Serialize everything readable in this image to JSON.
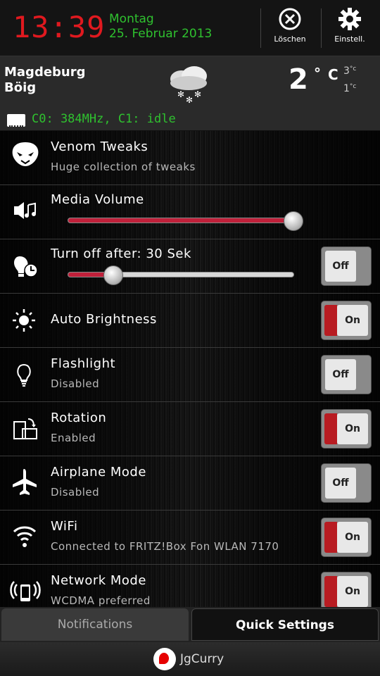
{
  "status": {
    "time": "13:39",
    "day": "Montag",
    "date": "25. Februar 2013",
    "clear_label": "Löschen",
    "settings_label": "Einstell."
  },
  "weather": {
    "city": "Magdeburg",
    "condition": "Böig",
    "temp": "2",
    "unit_deg": "°",
    "unit_c": "C",
    "high": "3",
    "low": "1",
    "small_unit": "°c"
  },
  "cpu": {
    "text": "C0: 384MHz, C1: idle"
  },
  "rows": {
    "venom": {
      "title": "Venom Tweaks",
      "subtitle": "Huge collection of tweaks"
    },
    "media": {
      "title": "Media Volume",
      "level": 1.0
    },
    "timeout": {
      "title": "Turn off after: 30 Sek",
      "level": 0.2,
      "toggle": "Off"
    },
    "brightness": {
      "title": "Auto Brightness",
      "toggle": "On"
    },
    "flashlight": {
      "title": "Flashlight",
      "subtitle": "Disabled",
      "toggle": "Off"
    },
    "rotation": {
      "title": "Rotation",
      "subtitle": "Enabled",
      "toggle": "On"
    },
    "airplane": {
      "title": "Airplane Mode",
      "subtitle": "Disabled",
      "toggle": "Off"
    },
    "wifi": {
      "title": "WiFi",
      "subtitle": "Connected to FRITZ!Box Fon WLAN 7170",
      "toggle": "On"
    },
    "network": {
      "title": "Network Mode",
      "subtitle": "WCDMA preferred",
      "toggle": "On"
    }
  },
  "tabs": {
    "notifications": "Notifications",
    "quick_settings": "Quick Settings"
  },
  "carrier": "JgCurry",
  "colors": {
    "clock": "#e0191f",
    "date": "#2fc12f",
    "slider_fill": "#c0203a",
    "toggle_on": "#b81c22"
  }
}
